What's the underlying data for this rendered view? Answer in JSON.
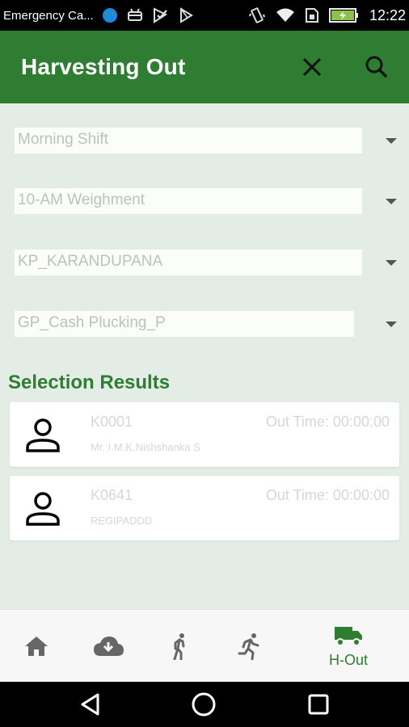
{
  "status_bar": {
    "title": "Emergency Ca...",
    "time": "12:22"
  },
  "app_bar": {
    "title": "Harvesting Out",
    "close_icon": "close-icon",
    "search_icon": "search-icon"
  },
  "filters": [
    {
      "value": "Morning Shift"
    },
    {
      "value": "10-AM Weighment"
    },
    {
      "value": "KP_KARANDUPANA"
    },
    {
      "value": "GP_Cash Plucking_P"
    }
  ],
  "results": {
    "title": "Selection Results",
    "items": [
      {
        "code": "K0001",
        "out_time": "Out Time: 00:00:00",
        "name": "Mr. I.M.K.Nishshanka S"
      },
      {
        "code": "K0641",
        "out_time": "Out Time: 00:00:00",
        "name": "REGIPADDD"
      }
    ]
  },
  "bottom_nav": {
    "items": [
      {
        "icon": "home-icon"
      },
      {
        "icon": "cloud-download-icon"
      },
      {
        "icon": "walk-icon"
      },
      {
        "icon": "run-icon"
      },
      {
        "icon": "truck-icon",
        "label": "H-Out"
      }
    ]
  },
  "colors": {
    "primary": "#2e7d32",
    "background": "#e4ece6",
    "card": "#ffffff"
  }
}
